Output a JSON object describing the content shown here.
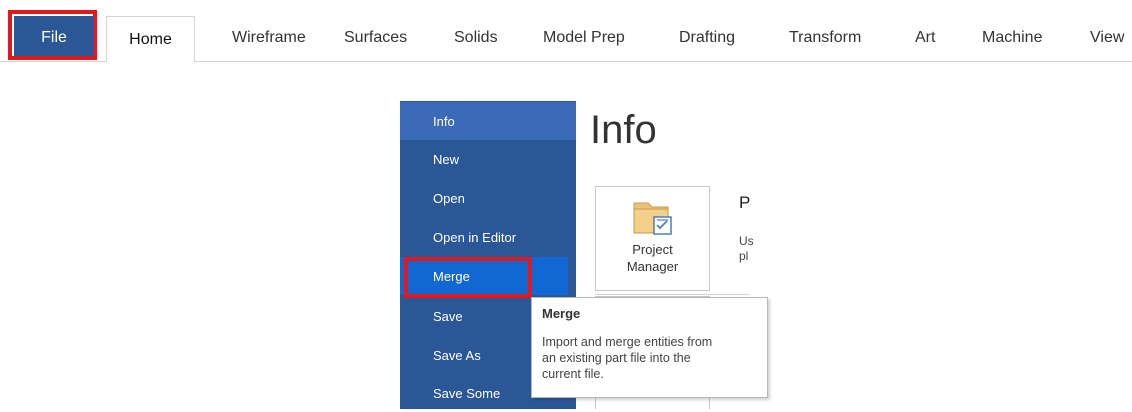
{
  "ribbon": {
    "file_label": "File",
    "tabs": [
      {
        "label": "Home"
      },
      {
        "label": "Wireframe"
      },
      {
        "label": "Surfaces"
      },
      {
        "label": "Solids"
      },
      {
        "label": "Model Prep"
      },
      {
        "label": "Drafting"
      },
      {
        "label": "Transform"
      },
      {
        "label": "Art"
      },
      {
        "label": "Machine"
      },
      {
        "label": "View"
      }
    ]
  },
  "backstage": {
    "menu": [
      {
        "label": "Info",
        "state": "active"
      },
      {
        "label": "New"
      },
      {
        "label": "Open"
      },
      {
        "label": "Open in Editor"
      },
      {
        "label": "Merge",
        "state": "hover"
      },
      {
        "label": "Save"
      },
      {
        "label": "Save As"
      },
      {
        "label": "Save Some"
      }
    ]
  },
  "info": {
    "title": "Info",
    "project_manager": {
      "label_line1": "Project",
      "label_line2": "Manager",
      "icon": "folder-checklist-icon",
      "heading": "P",
      "description": "Us\npl"
    }
  },
  "tooltip": {
    "title": "Merge",
    "body": "Import and merge entities from\nan existing part file into the\ncurrent file."
  },
  "colors": {
    "backstage_blue": "#2b5797",
    "active_item": "#3b6ab8",
    "hover_item": "#1168d4",
    "highlight_red": "#e0191f"
  }
}
